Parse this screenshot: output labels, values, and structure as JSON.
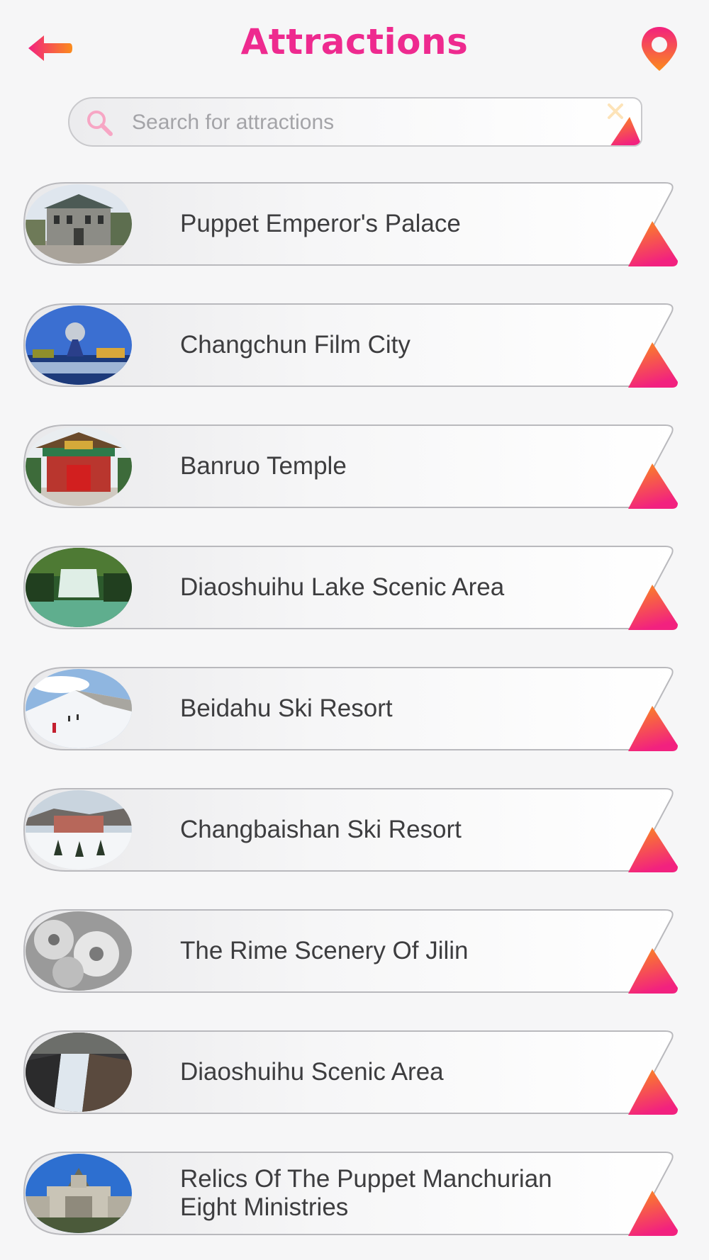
{
  "header": {
    "title": "Attractions",
    "back_icon": "back-arrow-icon",
    "map_icon": "map-pin-icon"
  },
  "search": {
    "placeholder": "Search for attractions",
    "value": "",
    "icon": "search-icon",
    "clear_icon": "close-icon"
  },
  "colors": {
    "accent": "#ee2a8f",
    "gradient_start": "#fb8c1c",
    "gradient_end": "#f2217f",
    "text": "#3d3d3f",
    "placeholder": "#a4a4a8"
  },
  "attractions": [
    {
      "name": "Puppet Emperor's Palace",
      "thumbnail": "mansion building"
    },
    {
      "name": "Changchun Film City",
      "thumbnail": "sphere monument with fountain"
    },
    {
      "name": "Banruo Temple",
      "thumbnail": "temple red gate"
    },
    {
      "name": "Diaoshuihu Lake Scenic Area",
      "thumbnail": "waterfall in forest"
    },
    {
      "name": "Beidahu Ski Resort",
      "thumbnail": "ski slope with skiers"
    },
    {
      "name": "Changbaishan Ski Resort",
      "thumbnail": "snowy resort buildings"
    },
    {
      "name": "The Rime Scenery Of Jilin",
      "thumbnail": "frost covered branches"
    },
    {
      "name": "Diaoshuihu Scenic Area",
      "thumbnail": "waterfall cliff"
    },
    {
      "name": "Relics Of The Puppet Manchurian Eight Ministries",
      "thumbnail": "historic ministry building"
    }
  ]
}
